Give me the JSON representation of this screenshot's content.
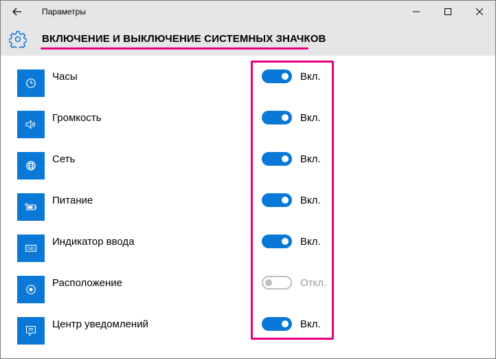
{
  "window": {
    "app_title": "Параметры",
    "controls": {
      "minimize": "minimize-icon",
      "maximize": "maximize-icon",
      "close": "close-icon"
    }
  },
  "header": {
    "title": "ВКЛЮЧЕНИЕ И ВЫКЛЮЧЕНИЕ СИСТЕМНЫХ ЗНАЧКОВ",
    "icon": "gear-icon",
    "underline_color": "#e6007e"
  },
  "colors": {
    "accent": "#0a78d7",
    "highlight": "#e6007e",
    "toggle_off": "#bfbfbf",
    "off_text": "#9a9a9a"
  },
  "items": [
    {
      "label": "Часы",
      "icon": "clock-icon",
      "on": true,
      "state": "Вкл."
    },
    {
      "label": "Громкость",
      "icon": "volume-icon",
      "on": true,
      "state": "Вкл."
    },
    {
      "label": "Сеть",
      "icon": "globe-icon",
      "on": true,
      "state": "Вкл."
    },
    {
      "label": "Питание",
      "icon": "battery-icon",
      "on": true,
      "state": "Вкл."
    },
    {
      "label": "Индикатор ввода",
      "icon": "keyboard-icon",
      "on": true,
      "state": "Вкл."
    },
    {
      "label": "Расположение",
      "icon": "location-icon",
      "on": false,
      "state": "Откл."
    },
    {
      "label": "Центр уведомлений",
      "icon": "notification-center-icon",
      "on": true,
      "state": "Вкл."
    }
  ]
}
